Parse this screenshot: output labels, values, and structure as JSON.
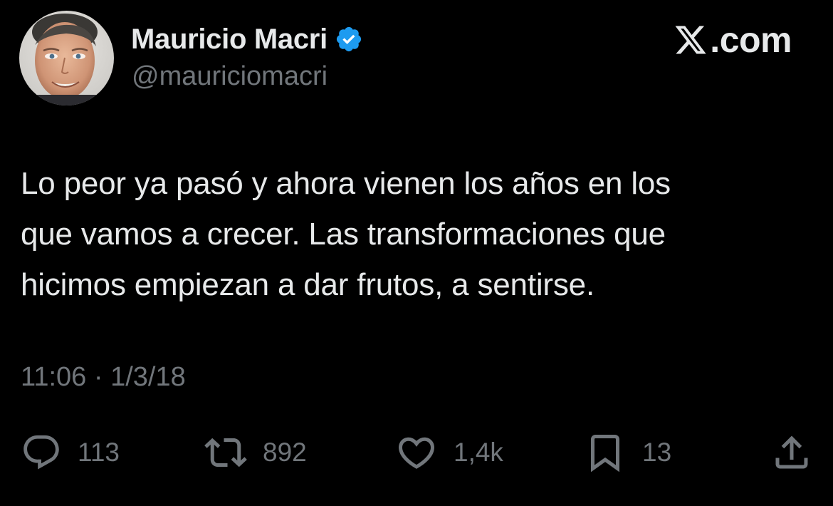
{
  "header": {
    "display_name": "Mauricio Macri",
    "handle": "@mauriciomacri",
    "verified_icon": "verified-badge-icon",
    "brand_text": ".com",
    "brand_icon": "x-logo-icon"
  },
  "tweet": {
    "text_lines": [
      "Lo peor ya pasó y ahora vienen los años en los",
      "que vamos a crecer. Las transformaciones que",
      "hicimos empiezan a dar frutos, a sentirse."
    ],
    "time": "11:06",
    "separator": "·",
    "date": "1/3/18"
  },
  "actions": {
    "replies": {
      "icon": "reply-icon",
      "count": "113"
    },
    "retweets": {
      "icon": "retweet-icon",
      "count": "892"
    },
    "likes": {
      "icon": "heart-icon",
      "count": "1,4k"
    },
    "bookmarks": {
      "icon": "bookmark-icon",
      "count": "13"
    },
    "share": {
      "icon": "share-icon"
    }
  },
  "colors": {
    "background": "#000000",
    "primary_text": "#e7e9ea",
    "secondary_text": "#71767b",
    "verified_blue": "#1d9bf0"
  }
}
